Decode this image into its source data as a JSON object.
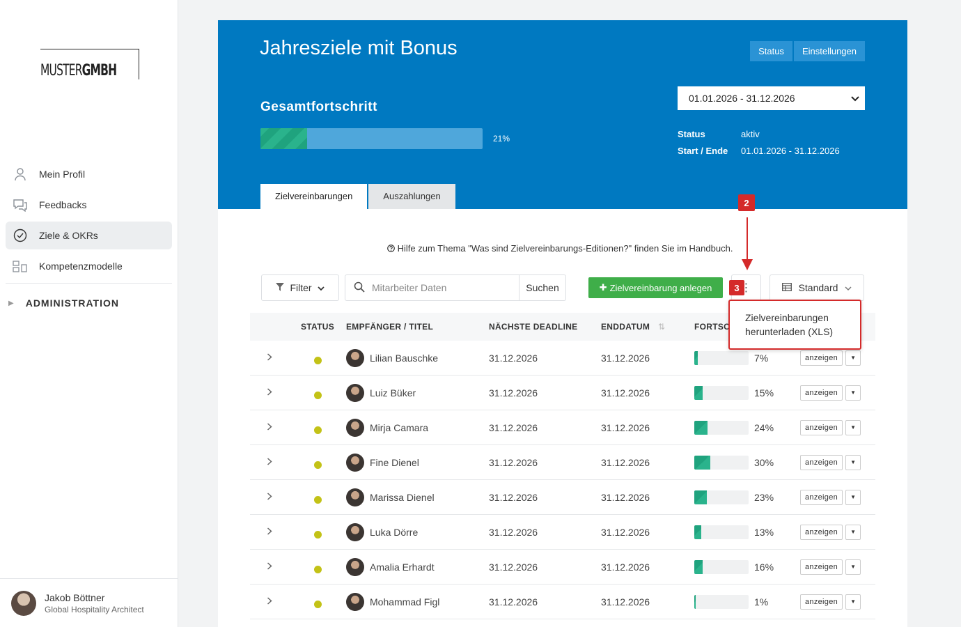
{
  "brand": {
    "part1": "MUSTER",
    "part2": "GMBH"
  },
  "nav": {
    "items": [
      {
        "label": "Mein Profil",
        "icon": "user-icon"
      },
      {
        "label": "Feedbacks",
        "icon": "chat-icon"
      },
      {
        "label": "Ziele & OKRs",
        "icon": "check-circle-icon",
        "active": true
      },
      {
        "label": "Kompetenzmodelle",
        "icon": "grid-icon"
      }
    ],
    "admin": "ADMINISTRATION"
  },
  "user": {
    "name": "Jakob Böttner",
    "role": "Global Hospitality Architect"
  },
  "header": {
    "title": "Jahresziele mit Bonus",
    "status_button": "Status",
    "settings_button": "Einstellungen",
    "progress_label": "Gesamtfortschritt",
    "progress_value": 0.21,
    "progress_text": "21%",
    "date_range": "01.01.2026 - 31.12.2026",
    "meta": {
      "status_key": "Status",
      "status_value": "aktiv",
      "range_key": "Start / Ende",
      "range_value": "01.01.2026 - 31.12.2026"
    },
    "tabs": [
      "Zielvereinbarungen",
      "Auszahlungen"
    ]
  },
  "help_text": "Hilfe zum Thema \"Was sind Zielvereinbarungs-Editionen?\" finden Sie im Handbuch.",
  "toolbar": {
    "filter": "Filter",
    "search_placeholder": "Mitarbeiter Daten",
    "search_button": "Suchen",
    "add_button": "Zielvereinbarung anlegen",
    "view_button": "Standard"
  },
  "table": {
    "headers": {
      "status": "STATUS",
      "recipient": "EMPFÄNGER / TITEL",
      "deadline": "NÄCHSTE DEADLINE",
      "end": "ENDDATUM",
      "progress": "FORTSCH"
    },
    "action_label": "anzeigen",
    "rows": [
      {
        "name": "Lilian Bauschke",
        "deadline": "31.12.2026",
        "end": "31.12.2026",
        "progress": 0.07,
        "progress_text": "7%"
      },
      {
        "name": "Luiz Büker",
        "deadline": "31.12.2026",
        "end": "31.12.2026",
        "progress": 0.15,
        "progress_text": "15%"
      },
      {
        "name": "Mirja Camara",
        "deadline": "31.12.2026",
        "end": "31.12.2026",
        "progress": 0.24,
        "progress_text": "24%"
      },
      {
        "name": "Fine Dienel",
        "deadline": "31.12.2026",
        "end": "31.12.2026",
        "progress": 0.3,
        "progress_text": "30%"
      },
      {
        "name": "Marissa Dienel",
        "deadline": "31.12.2026",
        "end": "31.12.2026",
        "progress": 0.23,
        "progress_text": "23%"
      },
      {
        "name": "Luka Dörre",
        "deadline": "31.12.2026",
        "end": "31.12.2026",
        "progress": 0.13,
        "progress_text": "13%"
      },
      {
        "name": "Amalia Erhardt",
        "deadline": "31.12.2026",
        "end": "31.12.2026",
        "progress": 0.16,
        "progress_text": "16%"
      },
      {
        "name": "Mohammad Figl",
        "deadline": "31.12.2026",
        "end": "31.12.2026",
        "progress": 0.01,
        "progress_text": "1%"
      }
    ]
  },
  "dropdown": {
    "line1": "Zielvereinbarungen",
    "line2": "herunterladen (XLS)"
  },
  "annotations": {
    "step2": "2",
    "step3": "3"
  },
  "colors": {
    "primary": "#0079c1",
    "success": "#3fae49",
    "progress": "#1fa37e",
    "status_dot": "#c3c217",
    "annotation": "#d42a2a"
  }
}
